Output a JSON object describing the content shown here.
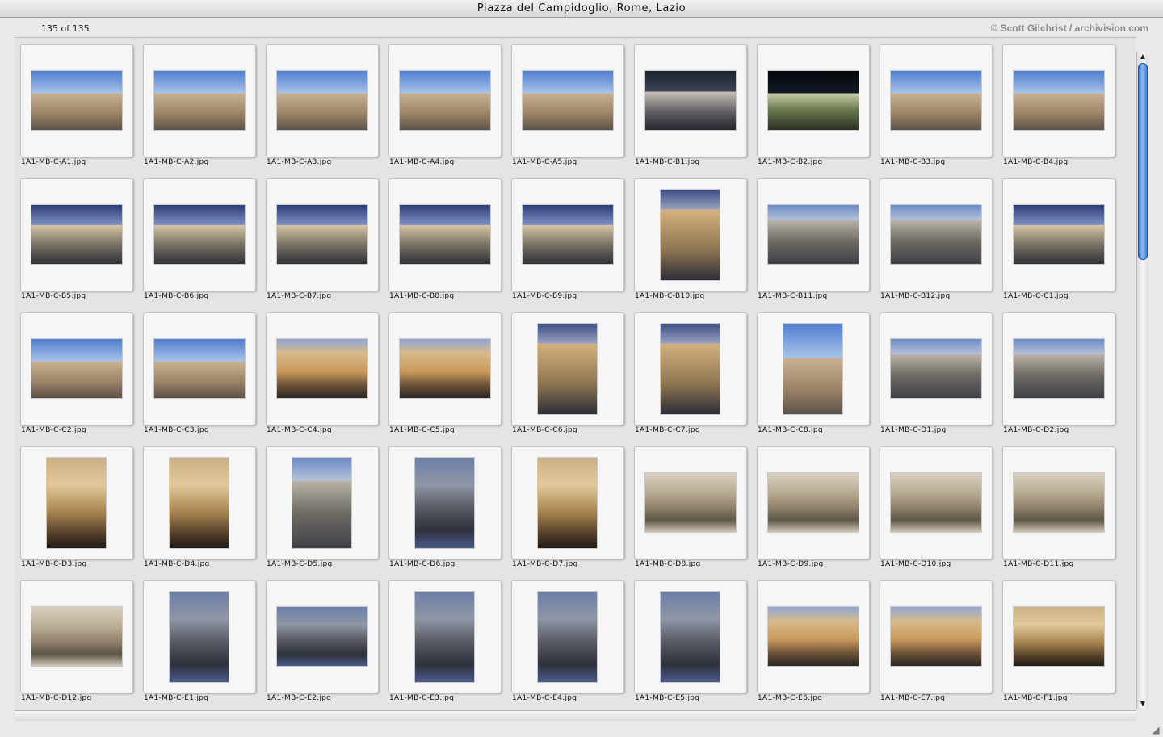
{
  "window": {
    "title": "Piazza del Campidoglio, Rome, Lazio"
  },
  "header": {
    "count": "135 of 135",
    "copyright": "© Scott Gilchrist / archivision.com"
  },
  "icons": {
    "scroll_up": "arrow-up-icon",
    "scroll_down": "arrow-down-icon",
    "resize": "resize-grip-icon"
  },
  "thumbnails": [
    {
      "name": "1A1-MB-C-A1.jpg",
      "o": "l",
      "c": "sky"
    },
    {
      "name": "1A1-MB-C-A2.jpg",
      "o": "l",
      "c": "sky"
    },
    {
      "name": "1A1-MB-C-A3.jpg",
      "o": "l",
      "c": "sky"
    },
    {
      "name": "1A1-MB-C-A4.jpg",
      "o": "l",
      "c": "sky"
    },
    {
      "name": "1A1-MB-C-A5.jpg",
      "o": "l",
      "c": "sky"
    },
    {
      "name": "1A1-MB-C-B1.jpg",
      "o": "l",
      "c": "dark"
    },
    {
      "name": "1A1-MB-C-B2.jpg",
      "o": "l",
      "c": "night"
    },
    {
      "name": "1A1-MB-C-B3.jpg",
      "o": "l",
      "c": "sky"
    },
    {
      "name": "1A1-MB-C-B4.jpg",
      "o": "l",
      "c": "sky"
    },
    {
      "name": "1A1-MB-C-B5.jpg",
      "o": "l",
      "c": "storm"
    },
    {
      "name": "1A1-MB-C-B6.jpg",
      "o": "l",
      "c": "storm"
    },
    {
      "name": "1A1-MB-C-B7.jpg",
      "o": "l",
      "c": "storm"
    },
    {
      "name": "1A1-MB-C-B8.jpg",
      "o": "l",
      "c": "storm"
    },
    {
      "name": "1A1-MB-C-B9.jpg",
      "o": "l",
      "c": "storm"
    },
    {
      "name": "1A1-MB-C-B10.jpg",
      "o": "p",
      "c": "dusk"
    },
    {
      "name": "1A1-MB-C-B11.jpg",
      "o": "l",
      "c": "stone"
    },
    {
      "name": "1A1-MB-C-B12.jpg",
      "o": "l",
      "c": "stone"
    },
    {
      "name": "1A1-MB-C-C1.jpg",
      "o": "l",
      "c": "storm"
    },
    {
      "name": "1A1-MB-C-C2.jpg",
      "o": "l",
      "c": "sky"
    },
    {
      "name": "1A1-MB-C-C3.jpg",
      "o": "l",
      "c": "sky"
    },
    {
      "name": "1A1-MB-C-C4.jpg",
      "o": "l",
      "c": "warm"
    },
    {
      "name": "1A1-MB-C-C5.jpg",
      "o": "l",
      "c": "warm"
    },
    {
      "name": "1A1-MB-C-C6.jpg",
      "o": "p",
      "c": "dusk"
    },
    {
      "name": "1A1-MB-C-C7.jpg",
      "o": "p",
      "c": "dusk"
    },
    {
      "name": "1A1-MB-C-C8.jpg",
      "o": "p",
      "c": "sky"
    },
    {
      "name": "1A1-MB-C-D1.jpg",
      "o": "l",
      "c": "stone"
    },
    {
      "name": "1A1-MB-C-D2.jpg",
      "o": "l",
      "c": "stone"
    },
    {
      "name": "1A1-MB-C-D3.jpg",
      "o": "p",
      "c": "gold"
    },
    {
      "name": "1A1-MB-C-D4.jpg",
      "o": "p",
      "c": "gold"
    },
    {
      "name": "1A1-MB-C-D5.jpg",
      "o": "p",
      "c": "stone"
    },
    {
      "name": "1A1-MB-C-D6.jpg",
      "o": "p",
      "c": "shade"
    },
    {
      "name": "1A1-MB-C-D7.jpg",
      "o": "p",
      "c": "gold"
    },
    {
      "name": "1A1-MB-C-D8.jpg",
      "o": "l",
      "c": "capital"
    },
    {
      "name": "1A1-MB-C-D9.jpg",
      "o": "l",
      "c": "capital"
    },
    {
      "name": "1A1-MB-C-D10.jpg",
      "o": "l",
      "c": "capital"
    },
    {
      "name": "1A1-MB-C-D11.jpg",
      "o": "l",
      "c": "capital"
    },
    {
      "name": "1A1-MB-C-D12.jpg",
      "o": "l",
      "c": "capital"
    },
    {
      "name": "1A1-MB-C-E1.jpg",
      "o": "p",
      "c": "shade"
    },
    {
      "name": "1A1-MB-C-E2.jpg",
      "o": "l",
      "c": "shade"
    },
    {
      "name": "1A1-MB-C-E3.jpg",
      "o": "p",
      "c": "shade"
    },
    {
      "name": "1A1-MB-C-E4.jpg",
      "o": "p",
      "c": "shade"
    },
    {
      "name": "1A1-MB-C-E5.jpg",
      "o": "p",
      "c": "shade"
    },
    {
      "name": "1A1-MB-C-E6.jpg",
      "o": "l",
      "c": "warm"
    },
    {
      "name": "1A1-MB-C-E7.jpg",
      "o": "l",
      "c": "warm"
    },
    {
      "name": "1A1-MB-C-F1.jpg",
      "o": "l",
      "c": "gold"
    }
  ]
}
